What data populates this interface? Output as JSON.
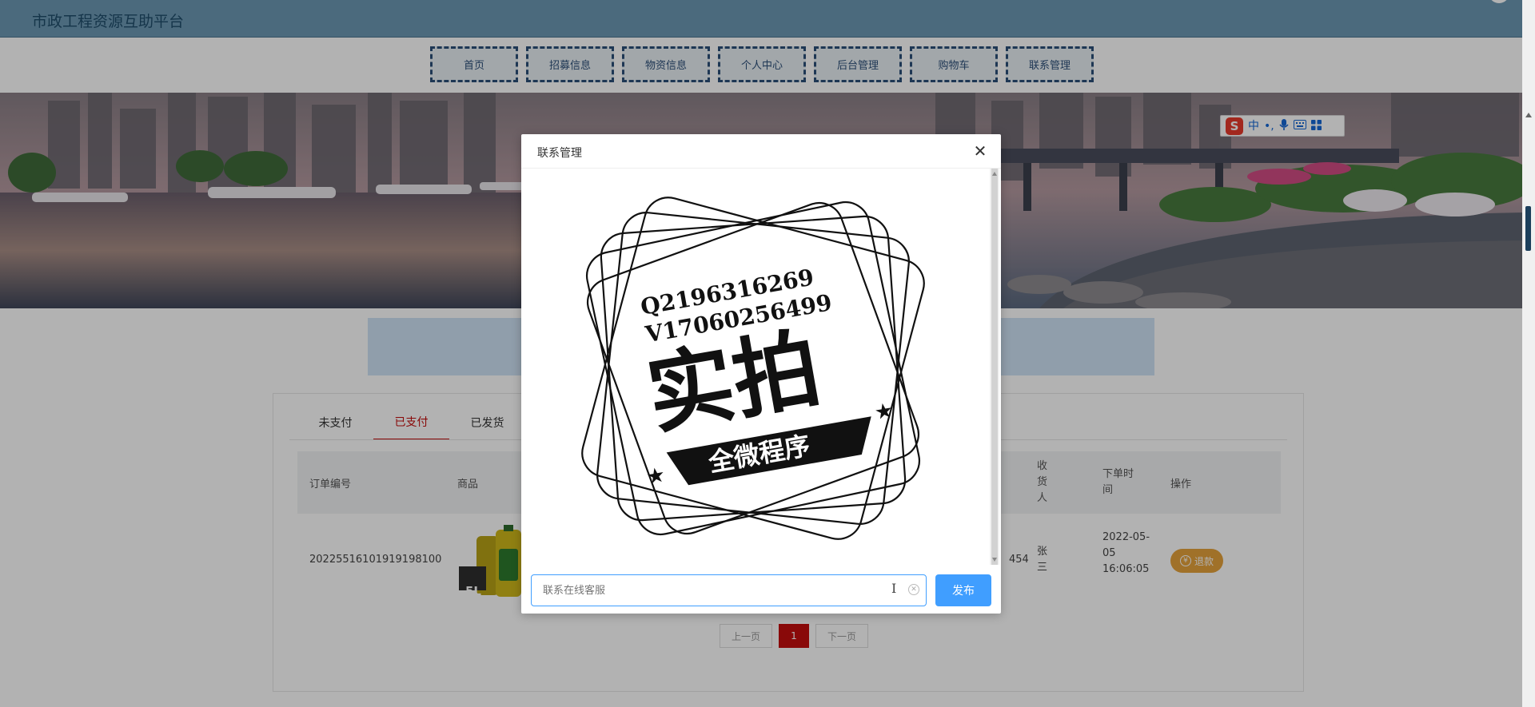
{
  "site": {
    "title": "市政工程资源互助平台"
  },
  "nav": {
    "items": [
      "首页",
      "招募信息",
      "物资信息",
      "个人中心",
      "后台管理",
      "购物车",
      "联系管理"
    ]
  },
  "ime": {
    "lang": "中",
    "punct": "•,",
    "icons": [
      "sogou-logo-icon",
      "mic-icon",
      "keyboard-icon",
      "grid-icon"
    ]
  },
  "orders": {
    "tabs": [
      "未支付",
      "已支付",
      "已发货"
    ],
    "active_tab": "已支付",
    "headers": {
      "order_no": "订单编号",
      "goods": "商品",
      "receiver": "收货人",
      "order_time": "下单时间",
      "action": "操作"
    },
    "row": {
      "order_no": "20225516101919198100",
      "goods_badge": "5L",
      "phone_tail": "454",
      "receiver": "张三",
      "order_time": "2022-05-05 16:06:05",
      "refund_label": "退款"
    },
    "pager": {
      "prev": "上一页",
      "page": "1",
      "next": "下一页"
    }
  },
  "modal": {
    "title": "联系管理",
    "stamp": {
      "line1": "Q2196316269",
      "line2": "V17060256499",
      "big": "实拍",
      "ribbon": "全微程序"
    },
    "input_placeholder": "联系在线客服",
    "send_label": "发布"
  },
  "colors": {
    "header": "#6c98b3",
    "nav_border": "#2c4f79",
    "accent_red": "#c40d0d",
    "primary": "#409eff",
    "refund": "#e6a23c"
  }
}
